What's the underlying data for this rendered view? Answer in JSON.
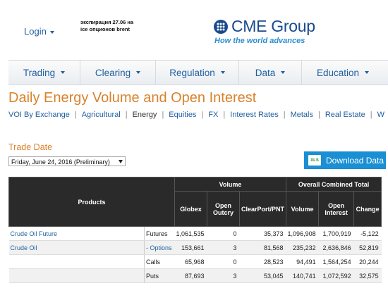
{
  "header": {
    "login_label": "Login",
    "notice_line1": "экспирация 27.06 на",
    "notice_line2": "ice опционов brent",
    "logo_text": "CME Group",
    "tagline": "How the world advances"
  },
  "nav": {
    "items": [
      {
        "label": "Trading"
      },
      {
        "label": "Clearing"
      },
      {
        "label": "Regulation"
      },
      {
        "label": "Data"
      },
      {
        "label": "Education"
      }
    ]
  },
  "page": {
    "title": "Daily Energy Volume and Open Interest",
    "subnav": [
      {
        "label": "VOI By Exchange"
      },
      {
        "label": "Agricultural"
      },
      {
        "label": "Energy"
      },
      {
        "label": "Equities"
      },
      {
        "label": "FX"
      },
      {
        "label": "Interest Rates"
      },
      {
        "label": "Metals"
      },
      {
        "label": "Real Estate"
      },
      {
        "label": "W"
      }
    ],
    "trade_date_label": "Trade Date",
    "trade_date_value": "Friday, June 24, 2016 (Preliminary)",
    "download_label": "Download Data",
    "xls_label": "XLS"
  },
  "table": {
    "col_products": "Products",
    "group_volume": "Volume",
    "group_oi": "Overall Combined Total",
    "columns": [
      "Globex",
      "Open Outcry",
      "ClearPort/PNT",
      "Volume",
      "Open Interest",
      "Change"
    ],
    "rows": [
      {
        "product": "Crude Oil Future",
        "type": "Futures",
        "values": [
          "1,061,535",
          "0",
          "35,373",
          "1,096,908",
          "1,700,919",
          "-5,122"
        ]
      },
      {
        "product": "Crude Oil",
        "type": "- Options",
        "values": [
          "153,661",
          "3",
          "81,568",
          "235,232",
          "2,636,846",
          "52,819"
        ]
      },
      {
        "product": "",
        "type": "Calls",
        "values": [
          "65,968",
          "0",
          "28,523",
          "94,491",
          "1,564,254",
          "20,244"
        ]
      },
      {
        "product": "",
        "type": "Puts",
        "values": [
          "87,693",
          "3",
          "53,045",
          "140,741",
          "1,072,592",
          "32,575"
        ]
      }
    ]
  },
  "colors": {
    "accent": "#d9822b",
    "link": "#1f5e9e",
    "button": "#1a8fd4",
    "table_header": "#2a2a2a"
  }
}
